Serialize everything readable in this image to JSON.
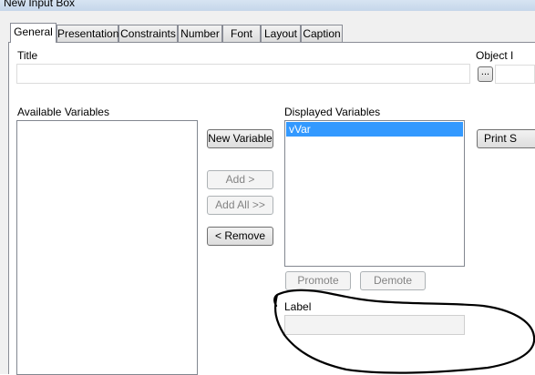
{
  "window": {
    "title": "New Input Box"
  },
  "tabs": [
    {
      "label": "General"
    },
    {
      "label": "Presentation"
    },
    {
      "label": "Constraints"
    },
    {
      "label": "Number"
    },
    {
      "label": "Font"
    },
    {
      "label": "Layout"
    },
    {
      "label": "Caption"
    }
  ],
  "general": {
    "title_label": "Title",
    "title_value": "",
    "object_label": "Object I",
    "ellipsis_label": "...",
    "available_label": "Available Variables",
    "available_items": [],
    "displayed_label": "Displayed Variables",
    "displayed_items": [
      "vVar"
    ],
    "new_variable_label": "New Variable",
    "add_label": "Add >",
    "add_all_label": "Add All >>",
    "remove_label": "< Remove",
    "print_label": "Print S",
    "promote_label": "Promote",
    "demote_label": "Demote",
    "label_label": "Label",
    "label_value": ""
  },
  "colors": {
    "selection": "#3399ff",
    "annotation": "#000000"
  }
}
